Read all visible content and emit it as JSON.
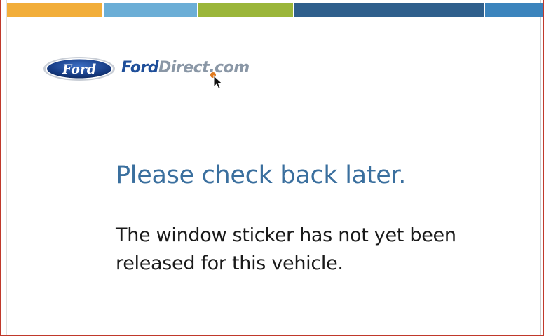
{
  "colors": {
    "stripes": [
      "#f2ae3a",
      "#6baed6",
      "#9bb63a",
      "#2f5f8c",
      "#3b84bd"
    ],
    "headline": "#3a6f9e",
    "body_text": "#1a1a1a",
    "ford_blue": "#1f4f9a",
    "brand_gray": "#8a97a6"
  },
  "logo": {
    "emblem_text": "Ford",
    "brand_part1": "Ford",
    "brand_part2": "Direct",
    "brand_part3": ".com"
  },
  "headline": "Please check back later.",
  "message": {
    "line1": "The window sticker has not yet been",
    "line2": "released for this vehicle."
  },
  "icons": {
    "cursor": "mouse-pointer-icon",
    "emblem": "ford-oval-logo"
  }
}
